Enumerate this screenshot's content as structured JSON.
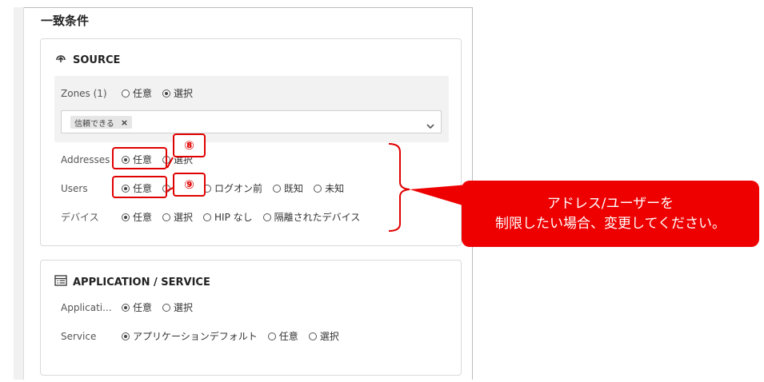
{
  "section": {
    "title": "一致条件"
  },
  "source": {
    "title": "SOURCE",
    "zones": {
      "label": "Zones (1)",
      "options": [
        "任意",
        "選択"
      ],
      "selected": "選択",
      "chip": "信頼できる",
      "chip_remove": "×"
    },
    "addresses": {
      "label": "Addresses",
      "options": [
        "任意",
        "選択"
      ],
      "selected": "任意"
    },
    "users": {
      "label": "Users",
      "options": [
        "任意",
        "選択",
        "ログオン前",
        "既知",
        "未知"
      ],
      "selected": "任意"
    },
    "device": {
      "label": "デバイス",
      "options": [
        "任意",
        "選択",
        "HIP なし",
        "隔離されたデバイス"
      ],
      "selected": "任意"
    }
  },
  "application": {
    "title": "APPLICATION / SERVICE",
    "applications": {
      "label": "Applicati...",
      "options": [
        "任意",
        "選択"
      ],
      "selected": "任意"
    },
    "service": {
      "label": "Service",
      "options": [
        "アプリケーションデフォルト",
        "任意",
        "選択"
      ],
      "selected": "アプリケーションデフォルト"
    }
  },
  "annotations": {
    "step8": "⑧",
    "step9": "⑨",
    "callout_line1": "アドレス/ユーザーを",
    "callout_line2": "制限したい場合、変更してください。",
    "color": "#ee0000"
  }
}
